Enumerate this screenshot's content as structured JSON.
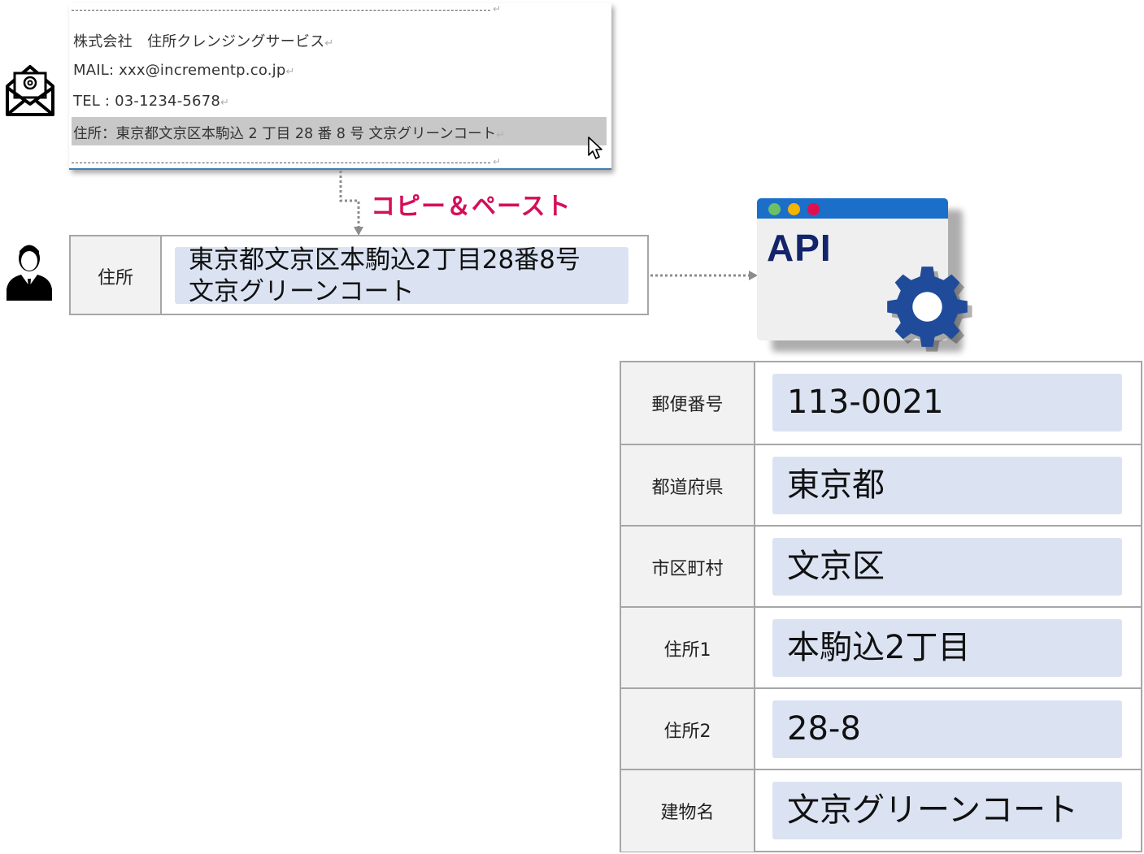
{
  "email": {
    "company": "株式会社　住所クレンジングサービス",
    "mail": "MAIL: xxx@incrementp.co.jp",
    "tel": "TEL : 03-1234-5678",
    "address": "住所：東京都文京区本駒込 2 丁目 28 番 8 号  文京グリーンコート",
    "return_mark": "↵"
  },
  "action": {
    "copy_paste_label": "コピー＆ペースト"
  },
  "address_form": {
    "label": "住所",
    "value_line1": "東京都文京区本駒込2丁目28番8号",
    "value_line2": "文京グリーンコート"
  },
  "api": {
    "label": "API"
  },
  "result": {
    "rows": [
      {
        "label": "郵便番号",
        "value": "113-0021"
      },
      {
        "label": "都道府県",
        "value": "東京都"
      },
      {
        "label": "市区町村",
        "value": "文京区"
      },
      {
        "label": "住所1",
        "value": "本駒込2丁目"
      },
      {
        "label": "住所2",
        "value": "28-8"
      },
      {
        "label": "建物名",
        "value": "文京グリーンコート"
      }
    ]
  },
  "colors": {
    "accent_pink": "#d40f5a",
    "api_title_blue": "#1b6fc9",
    "api_text_navy": "#12246b",
    "gear_blue": "#1f4b9a",
    "field_fill": "#dbe3f3",
    "label_fill": "#f2f2f2"
  },
  "icons": {
    "mail": "mail-open-icon",
    "user": "user-icon",
    "cursor": "cursor-icon",
    "gear": "gear-icon"
  }
}
